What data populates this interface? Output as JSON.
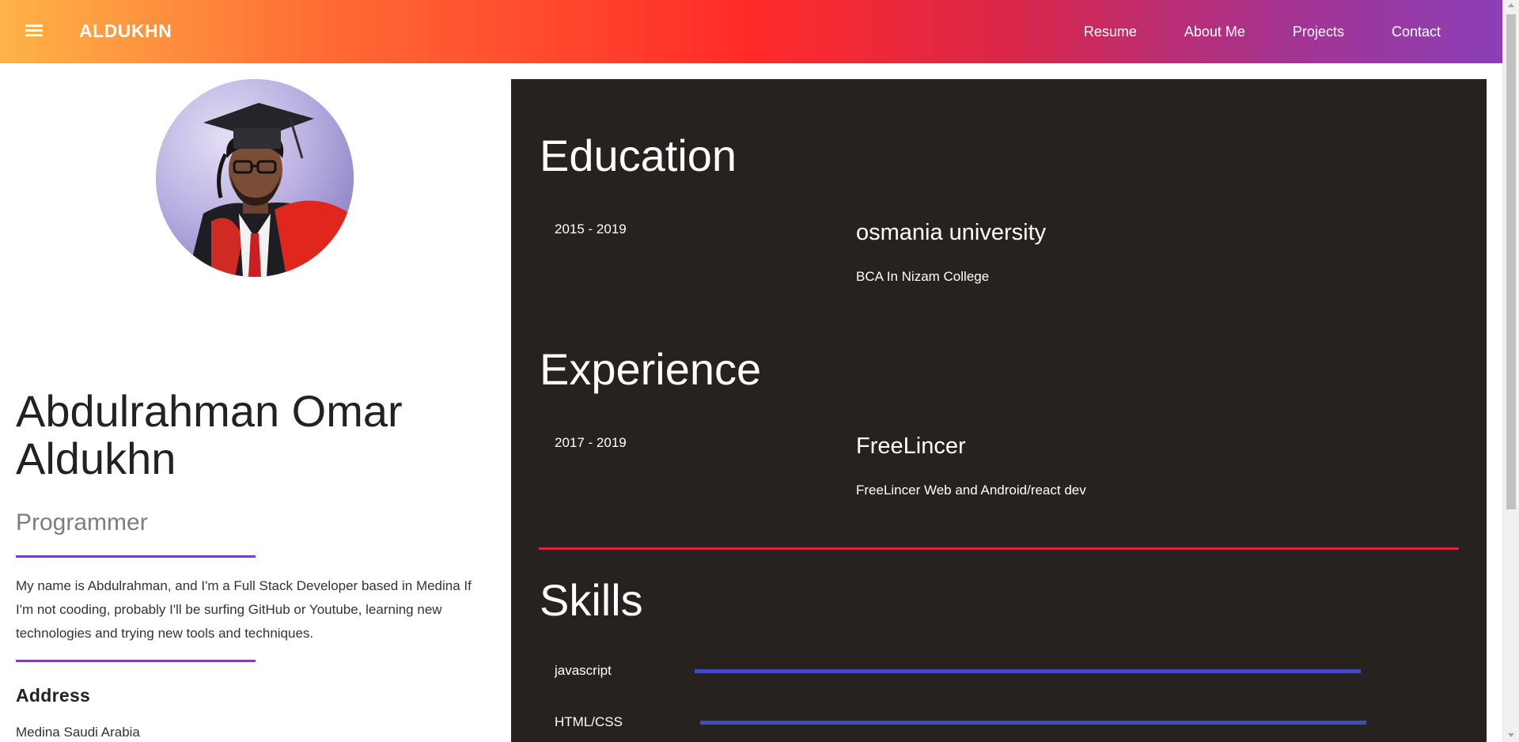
{
  "header": {
    "brand": "ALDUKHN",
    "nav": [
      "Resume",
      "About Me",
      "Projects",
      "Contact"
    ]
  },
  "profile": {
    "name": "Abdulrahman Omar Aldukhn",
    "role": "Programmer",
    "bio": "My name is Abdulrahman, and I'm a Full Stack Developer based in Medina If I'm not cooding, probably I'll be surfing GitHub or Youtube, learning new technologies and trying new tools and techniques.",
    "address_heading": "Address",
    "address_value": "Medina Saudi Arabia"
  },
  "education": {
    "title": "Education",
    "date": "2015 - 2019",
    "org": "osmania university",
    "desc": "BCA In Nizam College"
  },
  "experience": {
    "title": "Experience",
    "date": "2017 - 2019",
    "org": "FreeLincer",
    "desc": "FreeLincer Web and Android/react dev"
  },
  "skills": {
    "title": "Skills",
    "items": [
      {
        "label": "javascript",
        "level": 1.0
      },
      {
        "label": "HTML/CSS",
        "level": 1.0
      }
    ]
  },
  "colors": {
    "accent_purple": "#7b3fbf",
    "divider_red": "#d6253f",
    "skill_bar": "#3f4dbe",
    "panel_bg": "#272220"
  },
  "icons": {
    "menu": "hamburger-menu-icon"
  }
}
